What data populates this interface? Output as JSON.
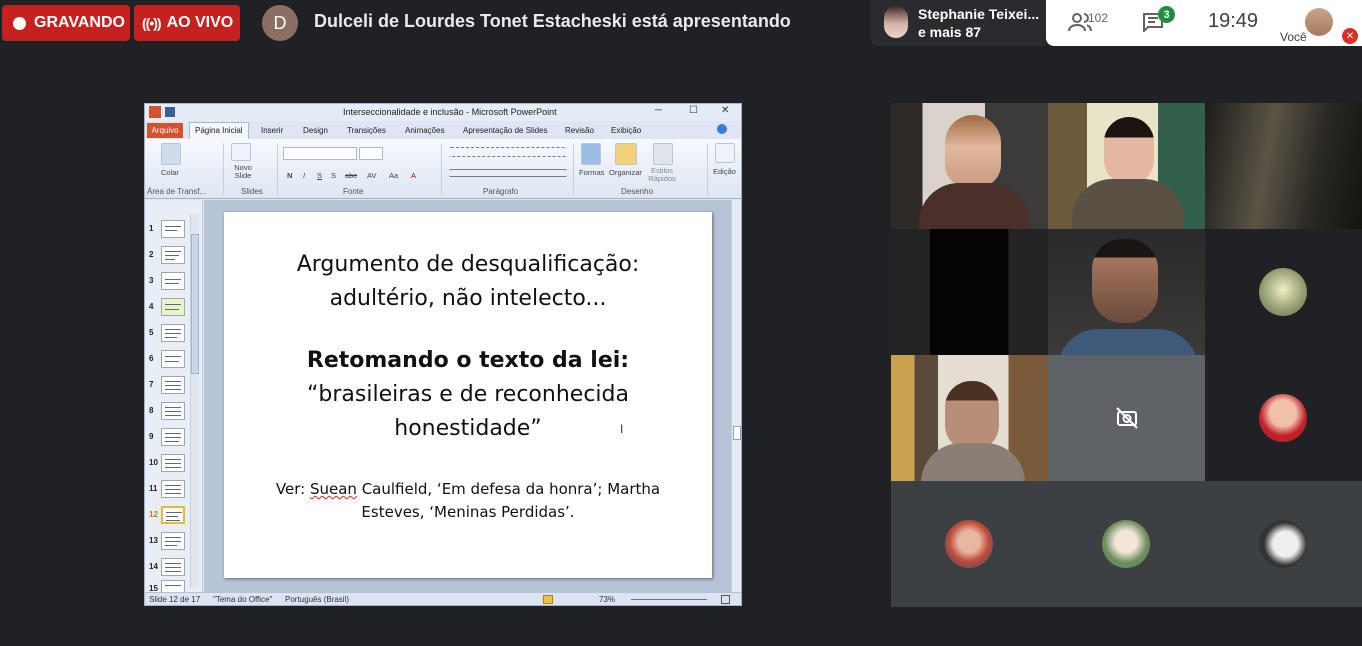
{
  "meet": {
    "recording_label": "GRAVANDO",
    "live_label": "AO VIVO",
    "presenter_initial": "D",
    "presenter_text": "Dulceli de Lourdes Tonet Estacheski está apresentando",
    "speaker_name": "Stephanie Teixei...",
    "speaker_more": "e mais 87",
    "participants_count": "102",
    "chat_badge": "3",
    "clock": "19:49",
    "self_label": "Você",
    "colors": {
      "recording": "#c5221f",
      "chat_badge": "#1e8e3e",
      "background": "#202124"
    }
  },
  "ppt": {
    "window_title": "Interseccionalidade e inclusão  -  Microsoft PowerPoint",
    "menu": {
      "file": "Arquivo",
      "tabs": [
        "Página Inicial",
        "Inserir",
        "Design",
        "Transições",
        "Animações",
        "Apresentação de Slides",
        "Revisão",
        "Exibição"
      ]
    },
    "ribbon": {
      "paste": "Colar",
      "new_slide": "Novo Slide",
      "shapes": "Formas",
      "organize": "Organizar",
      "quick_styles": "Estilos Rápidos",
      "edit": "Edição",
      "groups": [
        "Área de Transf...",
        "Slides",
        "Fonte",
        "Parágrafo",
        "Desenho"
      ],
      "format_buttons": [
        "N",
        "I",
        "S",
        "S",
        "abc",
        "AV",
        "Aa",
        "A"
      ]
    },
    "thumbnails": [
      "1",
      "2",
      "3",
      "4",
      "5",
      "6",
      "7",
      "8",
      "9",
      "10",
      "11",
      "12",
      "13",
      "14",
      "15"
    ],
    "slide": {
      "title_line1": "Argumento de desqualificação:",
      "title_line2": "adultério, não intelecto...",
      "bold_line": "Retomando o texto da lei:",
      "quote_line1": "“brasileiras e de reconhecida",
      "quote_line2": "honestidade”",
      "ref_prefix": "Ver: ",
      "ref_name": "Suean",
      "ref_line1_rest": " Caulfield, ‘Em defesa da honra’; Martha",
      "ref_line2": "Esteves, ‘Meninas Perdidas’."
    },
    "status": {
      "slide_count": "Slide 12 de 17",
      "theme": "\"Tema do Office\"",
      "language": "Português (Brasil)",
      "zoom": "73%"
    }
  }
}
